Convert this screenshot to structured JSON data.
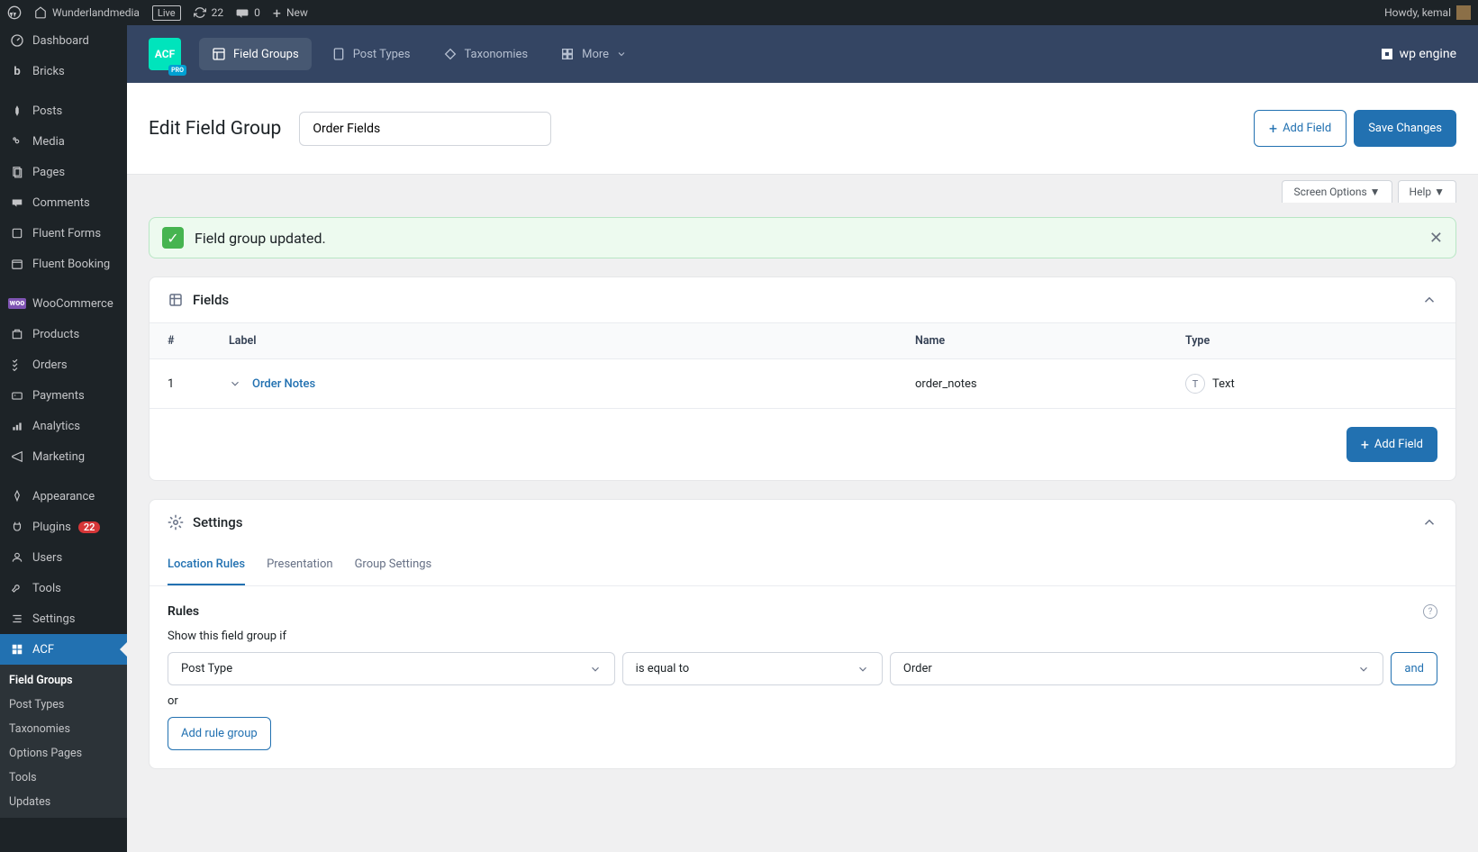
{
  "adminbar": {
    "site_name": "Wunderlandmedia",
    "live_badge": "Live",
    "refresh_count": "22",
    "comments_count": "0",
    "new_label": "New",
    "howdy": "Howdy, kemal"
  },
  "sidebar": {
    "items": [
      {
        "label": "Dashboard",
        "icon": "dashboard"
      },
      {
        "label": "Bricks",
        "icon": "bricks"
      },
      {
        "label": "Posts",
        "icon": "pin"
      },
      {
        "label": "Media",
        "icon": "media"
      },
      {
        "label": "Pages",
        "icon": "pages"
      },
      {
        "label": "Comments",
        "icon": "comments"
      },
      {
        "label": "Fluent Forms",
        "icon": "fluent"
      },
      {
        "label": "Fluent Booking",
        "icon": "booking"
      },
      {
        "label": "WooCommerce",
        "icon": "woo"
      },
      {
        "label": "Products",
        "icon": "products"
      },
      {
        "label": "Orders",
        "icon": "orders"
      },
      {
        "label": "Payments",
        "icon": "payments"
      },
      {
        "label": "Analytics",
        "icon": "analytics"
      },
      {
        "label": "Marketing",
        "icon": "marketing"
      },
      {
        "label": "Appearance",
        "icon": "appearance"
      },
      {
        "label": "Plugins",
        "icon": "plugins",
        "badge": "22"
      },
      {
        "label": "Users",
        "icon": "users"
      },
      {
        "label": "Tools",
        "icon": "tools"
      },
      {
        "label": "Settings",
        "icon": "settings"
      },
      {
        "label": "ACF",
        "icon": "acf",
        "active": true
      }
    ],
    "sub": [
      {
        "label": "Field Groups",
        "active": true
      },
      {
        "label": "Post Types"
      },
      {
        "label": "Taxonomies"
      },
      {
        "label": "Options Pages"
      },
      {
        "label": "Tools"
      },
      {
        "label": "Updates"
      }
    ]
  },
  "acf_header": {
    "nav": [
      {
        "label": "Field Groups",
        "active": true
      },
      {
        "label": "Post Types"
      },
      {
        "label": "Taxonomies"
      },
      {
        "label": "More"
      }
    ],
    "engine_label": "wp engine"
  },
  "page": {
    "title": "Edit Field Group",
    "title_input": "Order Fields",
    "add_field": "Add Field",
    "save": "Save Changes",
    "screen_options": "Screen Options",
    "help": "Help"
  },
  "notice": {
    "text": "Field group updated."
  },
  "fields_card": {
    "title": "Fields",
    "headers": {
      "num": "#",
      "label": "Label",
      "name": "Name",
      "type": "Type"
    },
    "rows": [
      {
        "num": "1",
        "label": "Order Notes",
        "name": "order_notes",
        "type": "Text"
      }
    ],
    "add_field": "Add Field"
  },
  "settings_card": {
    "title": "Settings",
    "tabs": [
      {
        "label": "Location Rules",
        "active": true
      },
      {
        "label": "Presentation"
      },
      {
        "label": "Group Settings"
      }
    ],
    "rules": {
      "title": "Rules",
      "label": "Show this field group if",
      "row": {
        "param": "Post Type",
        "operator": "is equal to",
        "value": "Order",
        "and": "and"
      },
      "or": "or",
      "add_rule": "Add rule group"
    }
  }
}
